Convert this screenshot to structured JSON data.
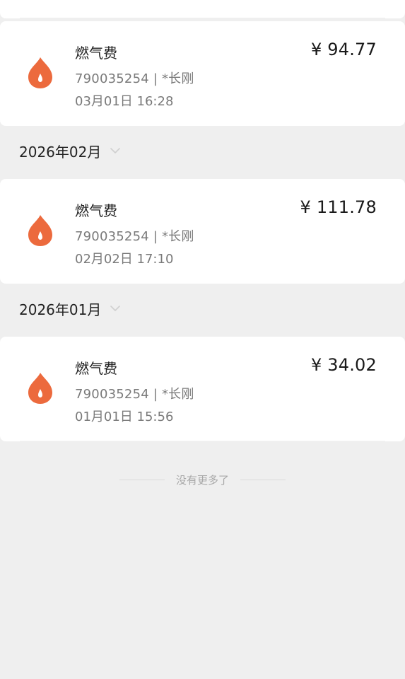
{
  "colors": {
    "flame": "#ec6a3d",
    "background": "#efefef",
    "card": "#ffffff"
  },
  "groups": [
    {
      "month": null,
      "record": {
        "title": "燃气费",
        "account": "790035254 | *长刚",
        "date": "03月01日 16:28",
        "amount": "¥ 94.77",
        "icon": "flame-icon"
      }
    },
    {
      "month": "2026年02月",
      "record": {
        "title": "燃气费",
        "account": "790035254 | *长刚",
        "date": "02月02日 17:10",
        "amount": "¥ 111.78",
        "icon": "flame-icon"
      }
    },
    {
      "month": "2026年01月",
      "record": {
        "title": "燃气费",
        "account": "790035254 | *长刚",
        "date": "01月01日 15:56",
        "amount": "¥ 34.02",
        "icon": "flame-icon"
      }
    }
  ],
  "footer": {
    "no_more": "没有更多了"
  }
}
